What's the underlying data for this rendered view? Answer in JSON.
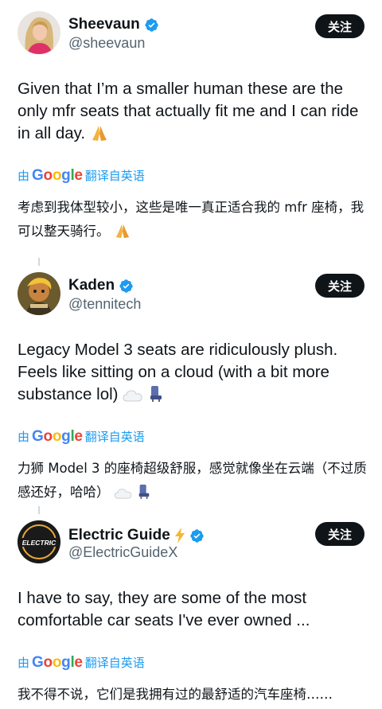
{
  "tweets": [
    {
      "name": "Sheevaun",
      "handle": "@sheevaun",
      "follow_label": "关注",
      "body": "Given that I’m a smaller human these are the only mfr seats that actually fit me and I can ride in all day.",
      "body_emoji": "folded-hands",
      "translate_prefix": "由",
      "translate_suffix": "翻译自英语",
      "translated": "考虑到我体型较小，这些是唯一真正适合我的 mfr 座椅，我可以整天骑行。",
      "translated_emoji": "folded-hands",
      "avatar_icon": "woman-portrait-avatar"
    },
    {
      "name": "Kaden",
      "handle": "@tennitech",
      "follow_label": "关注",
      "body": "Legacy Model 3 seats are ridiculously plush. Feels like sitting on a cloud (with a bit more substance lol)",
      "body_emoji": "cloud-seat",
      "translate_prefix": "由",
      "translate_suffix": "翻译自英语",
      "translated": "力狮 Model 3 的座椅超级舒服，感觉就像坐在云端（不过质感还好，哈哈）",
      "translated_emoji": "cloud-seat",
      "avatar_icon": "cartoon-avatar"
    },
    {
      "name": "Electric Guide",
      "handle": "@ElectricGuideX",
      "follow_label": "关注",
      "body": "I have to say, they are some of the most comfortable car seats I've ever owned ...",
      "translate_prefix": "由",
      "translate_suffix": "翻译自英语",
      "translated": "我不得不说，它们是我拥有过的最舒适的汽车座椅……",
      "avatar_icon": "electric-logo-avatar",
      "avatar_text": "ELECTRIC"
    }
  ],
  "google_word": "Google",
  "colors": {
    "verified": "#1d9bf0",
    "link": "#1d9bf0",
    "follow_bg": "#0f1419",
    "handle": "#536471",
    "lightning": "#f5b82e"
  }
}
